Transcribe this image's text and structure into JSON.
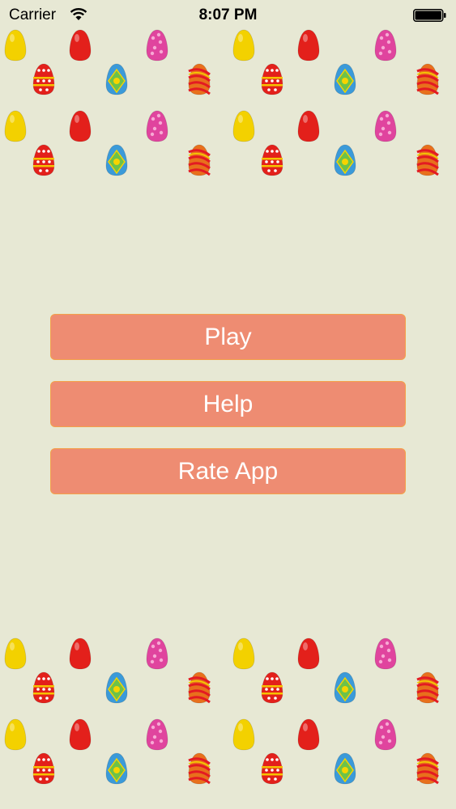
{
  "status_bar": {
    "carrier": "Carrier",
    "time": "8:07 PM",
    "wifi_icon": "wifi-icon",
    "battery_icon": "battery-full-icon"
  },
  "decorations": {
    "egg_types": [
      "yellow-egg-icon",
      "red-egg-icon",
      "pink-star-egg-icon",
      "red-floral-egg-icon",
      "blue-diamond-egg-icon",
      "orange-swirl-egg-icon"
    ],
    "colors": {
      "yellow": "#f3d100",
      "red": "#e3201b",
      "pink": "#e0449e",
      "blue": "#3b9ad9",
      "orange": "#e8701c"
    }
  },
  "menu": {
    "play_label": "Play",
    "help_label": "Help",
    "rate_label": "Rate App"
  },
  "theme": {
    "background": "#e7e8d4",
    "button_fill": "#ee8c72",
    "button_border": "#f3a14a",
    "button_text": "#ffffff"
  }
}
